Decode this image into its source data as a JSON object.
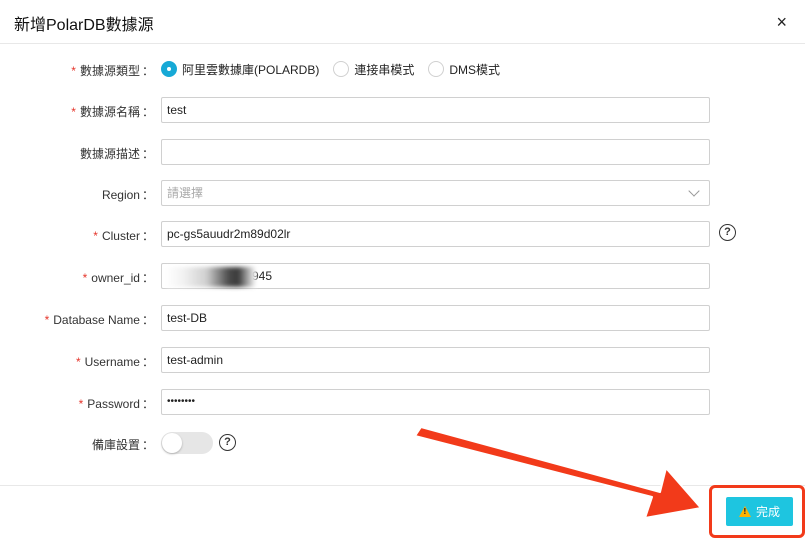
{
  "dialog": {
    "title": "新增PolarDB數據源",
    "close": "×"
  },
  "form": {
    "required_marker": "*",
    "colon": "：",
    "type": {
      "label": "數據源類型",
      "options": [
        "阿里雲數據庫(POLARDB)",
        "連接串模式",
        "DMS模式"
      ],
      "selected": "阿里雲數據庫(POLARDB)"
    },
    "name": {
      "label": "數據源名稱",
      "value": "test"
    },
    "desc": {
      "label": "數據源描述",
      "value": ""
    },
    "region": {
      "label": "Region",
      "placeholder": "請選擇"
    },
    "cluster": {
      "label": "Cluster",
      "value": "pc-gs5auudr2m89d02lr",
      "help": "?"
    },
    "owner": {
      "label": "owner_id",
      "value_visible": "945"
    },
    "dbname": {
      "label": "Database Name",
      "value": "test-DB"
    },
    "username": {
      "label": "Username",
      "value": "test-admin"
    },
    "password": {
      "label": "Password",
      "value": "••••••••"
    },
    "backup": {
      "label": "備庫設置",
      "enabled": false,
      "help": "?"
    }
  },
  "footer": {
    "done_label": "完成"
  },
  "colors": {
    "accent": "#17a9d6",
    "button": "#1ec5e0",
    "highlight": "#f23a1a",
    "required": "#e5352b"
  }
}
